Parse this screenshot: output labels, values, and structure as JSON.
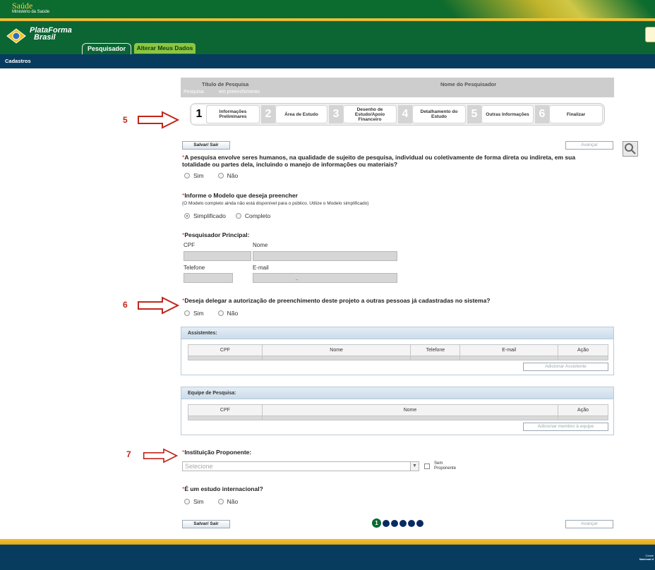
{
  "header": {
    "gov_title": "Saúde",
    "gov_subtitle": "Ministério da Saúde",
    "brand_line1": "PlataForma",
    "brand_line2": "Brasil",
    "tabs": [
      "Pesquisador",
      "Alterar Meus Dados"
    ]
  },
  "nav": {
    "item": "Cadastros"
  },
  "info": {
    "titulo_label": "Título de Pesquisa",
    "pesquisador_label": "Nome do Pesquisador",
    "status_prefix": "Pesquisa",
    "status_value": "em preenchimento"
  },
  "wizard": {
    "steps": [
      {
        "num": "1",
        "label": "Informações Preliminares"
      },
      {
        "num": "2",
        "label": "Área de Estudo"
      },
      {
        "num": "3",
        "label": "Desenho de Estudo/Apoio Financeiro"
      },
      {
        "num": "4",
        "label": "Detalhamento do Estudo"
      },
      {
        "num": "5",
        "label": "Outras Informações"
      },
      {
        "num": "6",
        "label": "Finalizar"
      }
    ]
  },
  "buttons": {
    "save": "Salvar/ Sair",
    "save2": "Salvar/ Sair",
    "next": "Avançar",
    "add_assistant": "Adicionar Assistente",
    "add_member": "Adicionar membro à equipe"
  },
  "annotations": [
    "5",
    "6",
    "7"
  ],
  "q1": {
    "req": "*",
    "text": "A pesquisa envolve seres humanos, na qualidade de sujeito de pesquisa, individual ou coletivamente de forma direta ou indireta, em sua totalidade ou partes dela, incluindo o manejo de informações ou materiais?",
    "options": [
      "Sim",
      "Não"
    ]
  },
  "q2": {
    "req": "*",
    "text": "Informe o Modelo que deseja preencher",
    "note": "(O Modelo completo ainda não está disponível para o público. Utilize o Modelo simplificado)",
    "options": [
      "Simplificado",
      "Completo"
    ]
  },
  "q3": {
    "req": "*",
    "text": "Pesquisador Principal:",
    "cpf": "CPF",
    "nome": "Nome",
    "telefone": "Telefone",
    "email": "E-mail",
    "email_value": "_"
  },
  "q4": {
    "req": "*",
    "text": "Deseja delegar a autorização de preenchimento deste projeto a outras pessoas já cadastradas no sistema?",
    "options": [
      "Sim",
      "Não"
    ]
  },
  "assistentes": {
    "title": "Assistentes:",
    "columns": [
      "CPF",
      "Nome",
      "Telefone",
      "E-mail",
      "Ação"
    ]
  },
  "equipe": {
    "title": "Equipe de Pesquisa:",
    "columns": [
      "CPF",
      "Nome",
      "Ação"
    ]
  },
  "q5": {
    "req": "*",
    "text": "Instituição Proponente:",
    "select_placeholder": "Selecione",
    "checkbox_label_1": "Sem",
    "checkbox_label_2": "Proponente"
  },
  "q6": {
    "req": "*",
    "text": "É um estudo internacional?",
    "options": [
      "Sim",
      "Não"
    ]
  },
  "pager": {
    "current": "1"
  },
  "footer": {
    "line1": "Conse",
    "line2": "Nacional d"
  },
  "colors": {
    "gov_green": "#0c6b2e",
    "nav_blue": "#073c5e",
    "tab_green": "#8cc63f",
    "required_red": "#d42a1f",
    "annotation_red": "#c0261c"
  }
}
